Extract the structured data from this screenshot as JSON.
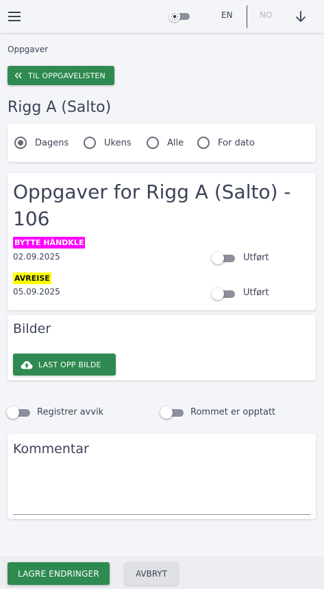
{
  "header": {
    "menu_icon": "menu-icon",
    "theme_icon": "sun-icon",
    "lang_en": "EN",
    "lang_no": "NO",
    "download_icon": "arrow-down-icon"
  },
  "breadcrumb": "Oppgaver",
  "back_button": {
    "icon": "double-chevron-left-icon",
    "label": "TIL OPPGAVELISTEN"
  },
  "page_title": "Rigg A (Salto)",
  "filter": {
    "selected": "Dagens",
    "options": [
      "Dagens",
      "Ukens",
      "Alle",
      "For dato"
    ]
  },
  "tasks": {
    "title": "Oppgaver for Rigg A (Salto) - 106",
    "items": [
      {
        "tag": "BYTTE HÅNDKLE",
        "tag_color": "#ff00ff",
        "date": "02.09.2025",
        "toggle_label": "Utført",
        "done": false
      },
      {
        "tag": "AVREISE",
        "tag_color": "#ffff00",
        "date": "05.09.2025",
        "toggle_label": "Utført",
        "done": false
      }
    ]
  },
  "images": {
    "title": "Bilder",
    "upload_icon": "cloud-upload-icon",
    "upload_label": "LAST OPP BILDE"
  },
  "toggles": {
    "deviation_label": "Registrer avvik",
    "occupied_label": "Rommet er opptatt"
  },
  "comment": {
    "label": "Kommentar",
    "value": ""
  },
  "footer": {
    "save_label": "LAGRE ENDRINGER",
    "cancel_label": "AVBRYT"
  },
  "colors": {
    "primary": "#2e8a50",
    "text": "#3c4257",
    "background": "#f4f5f8"
  }
}
